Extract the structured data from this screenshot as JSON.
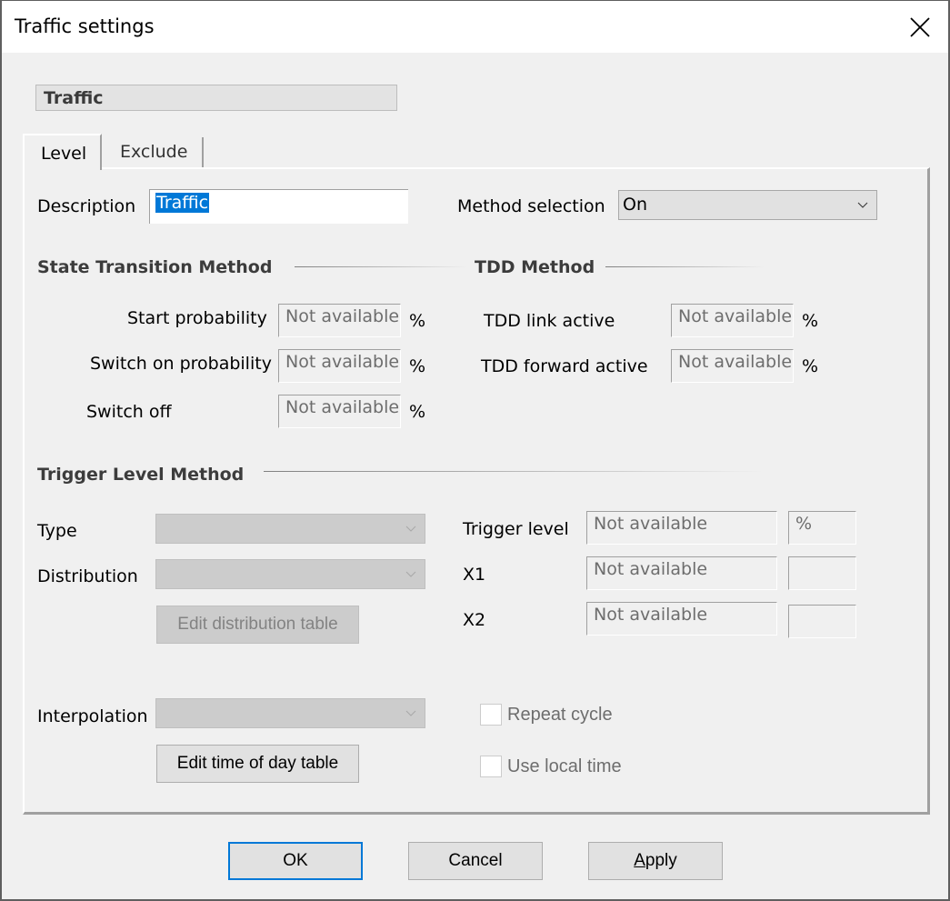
{
  "window": {
    "title": "Traffic settings",
    "close_icon": "close-x-icon"
  },
  "header": {
    "name": "Traffic"
  },
  "tabs": [
    {
      "label": "Level",
      "active": true
    },
    {
      "label": "Exclude",
      "active": false
    }
  ],
  "description": {
    "label": "Description",
    "value": "Traffic"
  },
  "method_selection": {
    "label": "Method selection",
    "value": "On"
  },
  "state_transition": {
    "title": "State Transition Method",
    "fields": [
      {
        "label": "Start probability",
        "value": "Not available",
        "unit": "%"
      },
      {
        "label": "Switch on probability",
        "value": "Not available",
        "unit": "%"
      },
      {
        "label": "Switch off",
        "value": "Not available",
        "unit": "%"
      }
    ]
  },
  "tdd": {
    "title": "TDD Method",
    "fields": [
      {
        "label": "TDD link active",
        "value": "Not available",
        "unit": "%"
      },
      {
        "label": "TDD forward active",
        "value": "Not available",
        "unit": "%"
      }
    ]
  },
  "trigger": {
    "title": "Trigger Level Method",
    "type_label": "Type",
    "type_value": "",
    "distribution_label": "Distribution",
    "distribution_value": "",
    "edit_distribution_label": "Edit distribution table",
    "fields": [
      {
        "label": "Trigger level",
        "value": "Not available",
        "unit": "%"
      },
      {
        "label": "X1",
        "value": "Not available",
        "unit": ""
      },
      {
        "label": "X2",
        "value": "Not available",
        "unit": ""
      }
    ],
    "interpolation_label": "Interpolation",
    "interpolation_value": "",
    "edit_time_label": "Edit time of day table",
    "repeat_cycle_label": "Repeat cycle",
    "repeat_cycle_checked": false,
    "use_local_time_label": "Use local time",
    "use_local_time_checked": false
  },
  "footer": {
    "ok_label": "OK",
    "cancel_label": "Cancel",
    "apply_label": "Apply",
    "apply_mnemonic": "A"
  },
  "colors": {
    "selection": "#0078d7",
    "default_button_border": "#0078d7",
    "dialog_bg": "#f0f0f0"
  }
}
